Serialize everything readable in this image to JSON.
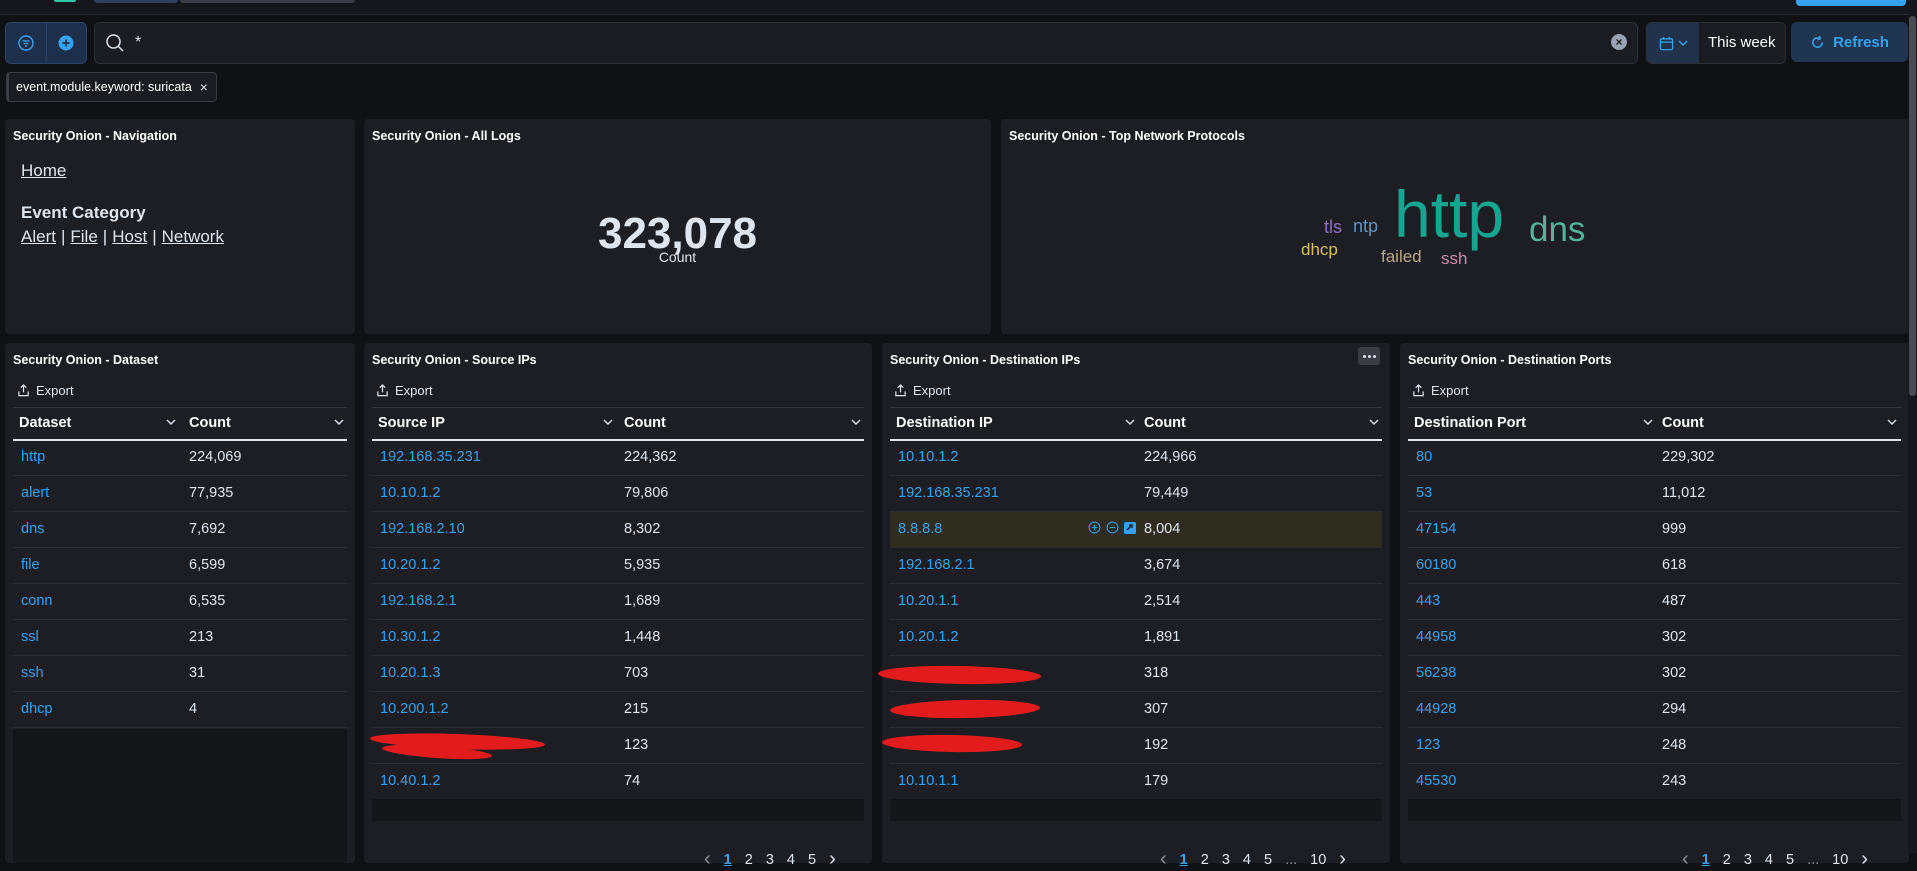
{
  "query": {
    "value": "*"
  },
  "date_picker": {
    "label": "This week"
  },
  "refresh": {
    "label": "Refresh"
  },
  "filter_pill": {
    "label": "event.module.keyword: suricata"
  },
  "panels": {
    "navigation": {
      "title": "Security Onion - Navigation",
      "home": "Home",
      "category_heading": "Event Category",
      "links": [
        "Alert",
        "File",
        "Host",
        "Network"
      ]
    },
    "all_logs": {
      "title": "Security Onion - All Logs",
      "value": "323,078",
      "caption": "Count"
    },
    "protocols": {
      "title": "Security Onion - Top Network Protocols",
      "words": [
        {
          "text": "http",
          "color": "#16a58f"
        },
        {
          "text": "dns",
          "color": "#54b399"
        },
        {
          "text": "tls",
          "color": "#9170b8"
        },
        {
          "text": "ntp",
          "color": "#6092c0"
        },
        {
          "text": "dhcp",
          "color": "#d6bf57"
        },
        {
          "text": "failed",
          "color": "#b9a888"
        },
        {
          "text": "ssh",
          "color": "#ca8eae"
        }
      ]
    },
    "dataset": {
      "title": "Security Onion - Dataset",
      "export": "Export",
      "col1": "Dataset",
      "col2": "Count",
      "rows": [
        [
          "http",
          "224,069"
        ],
        [
          "alert",
          "77,935"
        ],
        [
          "dns",
          "7,692"
        ],
        [
          "file",
          "6,599"
        ],
        [
          "conn",
          "6,535"
        ],
        [
          "ssl",
          "213"
        ],
        [
          "ssh",
          "31"
        ],
        [
          "dhcp",
          "4"
        ]
      ]
    },
    "source_ips": {
      "title": "Security Onion - Source IPs",
      "export": "Export",
      "col1": "Source IP",
      "col2": "Count",
      "rows": [
        [
          "192.168.35.231",
          "224,362"
        ],
        [
          "10.10.1.2",
          "79,806"
        ],
        [
          "192.168.2.10",
          "8,302"
        ],
        [
          "10.20.1.2",
          "5,935"
        ],
        [
          "192.168.2.1",
          "1,689"
        ],
        [
          "10.30.1.2",
          "1,448"
        ],
        [
          "10.20.1.3",
          "703"
        ],
        [
          "10.200.1.2",
          "215"
        ],
        [
          "",
          "123"
        ],
        [
          "10.40.1.2",
          "74"
        ]
      ],
      "pages": [
        "1",
        "2",
        "3",
        "4",
        "5"
      ]
    },
    "dest_ips": {
      "title": "Security Onion - Destination IPs",
      "export": "Export",
      "col1": "Destination IP",
      "col2": "Count",
      "rows": [
        [
          "10.10.1.2",
          "224,966"
        ],
        [
          "192.168.35.231",
          "79,449"
        ],
        [
          "8.8.8.8",
          "8,004"
        ],
        [
          "192.168.2.1",
          "3,674"
        ],
        [
          "10.20.1.1",
          "2,514"
        ],
        [
          "10.20.1.2",
          "1,891"
        ],
        [
          "",
          "318"
        ],
        [
          "",
          "307"
        ],
        [
          "",
          "192"
        ],
        [
          "10.10.1.1",
          "179"
        ]
      ],
      "pages": [
        "1",
        "2",
        "3",
        "4",
        "5",
        "...",
        "10"
      ]
    },
    "dest_ports": {
      "title": "Security Onion - Destination Ports",
      "export": "Export",
      "col1": "Destination Port",
      "col2": "Count",
      "rows": [
        [
          "80",
          "229,302"
        ],
        [
          "53",
          "11,012"
        ],
        [
          "47154",
          "999"
        ],
        [
          "60180",
          "618"
        ],
        [
          "443",
          "487"
        ],
        [
          "44958",
          "302"
        ],
        [
          "56238",
          "302"
        ],
        [
          "44928",
          "294"
        ],
        [
          "123",
          "248"
        ],
        [
          "45530",
          "243"
        ]
      ],
      "pages": [
        "1",
        "2",
        "3",
        "4",
        "5",
        "...",
        "10"
      ]
    }
  }
}
